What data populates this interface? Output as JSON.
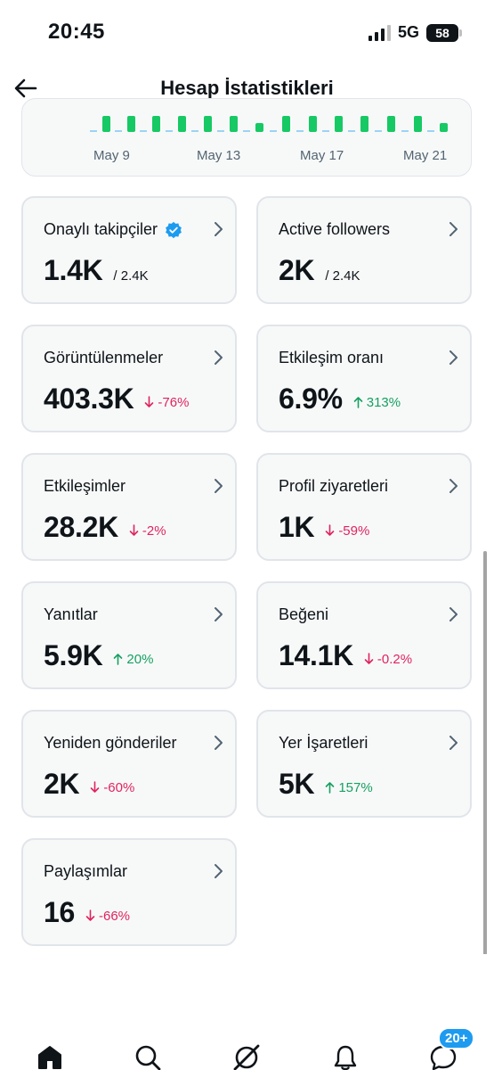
{
  "status_bar": {
    "time": "20:45",
    "network": "5G",
    "battery": "58",
    "signal_bars_active": 3,
    "signal_bars_total": 4
  },
  "header": {
    "title": "Hesap İstatistikleri",
    "back_icon": "arrow-left-icon"
  },
  "chart_data": {
    "type": "bar",
    "x_tick_labels": [
      "May 9",
      "May 13",
      "May 17",
      "May 21"
    ],
    "bar_color": "#17c964",
    "baseline_color": "#9bd3f5"
  },
  "stats": [
    {
      "id": "onayli-takipciler",
      "label": "Onaylı takipçiler",
      "verified": true,
      "value": "1.4K",
      "sub": "/ 2.4K"
    },
    {
      "id": "active-followers",
      "label": "Active followers",
      "value": "2K",
      "sub": "/ 2.4K"
    },
    {
      "id": "goruntulenmeler",
      "label": "Görüntülenmeler",
      "value": "403.3K",
      "delta": "-76%",
      "trend": "down"
    },
    {
      "id": "etkilesim-orani",
      "label": "Etkileşim oranı",
      "value": "6.9%",
      "delta": "313%",
      "trend": "up"
    },
    {
      "id": "etkilesimler",
      "label": "Etkileşimler",
      "value": "28.2K",
      "delta": "-2%",
      "trend": "down"
    },
    {
      "id": "profil-ziyaretleri",
      "label": "Profil ziyaretleri",
      "value": "1K",
      "delta": "-59%",
      "trend": "down"
    },
    {
      "id": "yanitlar",
      "label": "Yanıtlar",
      "value": "5.9K",
      "delta": "20%",
      "trend": "up"
    },
    {
      "id": "begeni",
      "label": "Beğeni",
      "value": "14.1K",
      "delta": "-0.2%",
      "trend": "down"
    },
    {
      "id": "yeniden-gonderiler",
      "label": "Yeniden gönderiler",
      "value": "2K",
      "delta": "-60%",
      "trend": "down"
    },
    {
      "id": "yer-isaretleri",
      "label": "Yer İşaretleri",
      "value": "5K",
      "delta": "157%",
      "trend": "up"
    },
    {
      "id": "paylasimlar",
      "label": "Paylaşımlar",
      "value": "16",
      "delta": "-66%",
      "trend": "down"
    }
  ],
  "colors": {
    "down": "#e0245e",
    "up": "#17a060",
    "accent": "#1d9bf0",
    "card_bg": "#f7f9f9",
    "card_border": "#e1e5ea"
  },
  "bottom_nav": [
    {
      "name": "home-icon",
      "active": true
    },
    {
      "name": "search-icon"
    },
    {
      "name": "grok-icon"
    },
    {
      "name": "bell-icon"
    },
    {
      "name": "messages-icon",
      "badge": "20+"
    }
  ]
}
